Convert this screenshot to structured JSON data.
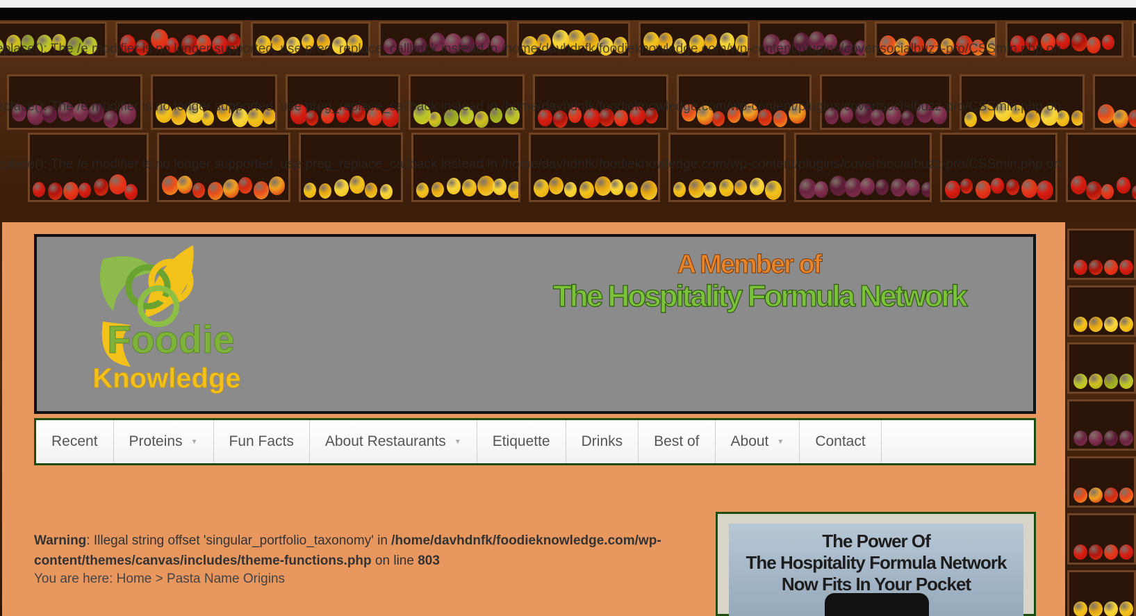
{
  "php_warnings": [
    "eplace(): The /e modifier is no longer supported, use preg_replace_callback instead in /home/davhdnfk/foodieknowledge.com/wp-content/plugins/covertsocialbuzz-pro/CSSmin.php on",
    "eplace(): The /e modifier is no longer supported, use preg_replace_callback instead in /home/davhdnfk/foodieknowledge.com/wp-content/plugins/covertsocialbuzz-pro/CSSmin.php on",
    "eplace(): The /e modifier is no longer supported, use preg_replace_callback instead in /home/davhdnfk/foodieknowledge.com/wp-content/plugins/covertsocialbuzz-pro/CSSmin.php on"
  ],
  "header": {
    "logo_line1": "Foodie",
    "logo_line2": "Knowledge",
    "member_line1": "A Member of",
    "member_line2": "The Hospitality Formula Network"
  },
  "nav": {
    "items": [
      {
        "label": "Recent",
        "dropdown": false
      },
      {
        "label": "Proteins",
        "dropdown": true
      },
      {
        "label": "Fun Facts",
        "dropdown": false
      },
      {
        "label": "About Restaurants",
        "dropdown": true
      },
      {
        "label": "Etiquette",
        "dropdown": false
      },
      {
        "label": "Drinks",
        "dropdown": false
      },
      {
        "label": "Best of",
        "dropdown": false
      },
      {
        "label": "About",
        "dropdown": true
      },
      {
        "label": "Contact",
        "dropdown": false
      }
    ]
  },
  "warning": {
    "label": "Warning",
    "text1": ": Illegal string offset 'singular_portfolio_taxonomy' in ",
    "path": "/home/davhdnfk/foodieknowledge.com/wp-content/themes/canvas/includes/theme-functions.php",
    "text2": " on line ",
    "line": "803"
  },
  "breadcrumb": {
    "prefix": "You are here: ",
    "home": "Home",
    "separator": " > ",
    "current": "Pasta Name Origins"
  },
  "sidebar_ad": {
    "line1": "The Power Of",
    "line2": "The Hospitality Formula Network",
    "line3": "Now Fits In Your Pocket"
  },
  "colors": {
    "page_bg": "#e8975f",
    "header_bg": "#8b8b8b",
    "nav_border": "#1f4a10",
    "logo_green": "#7fb23a",
    "logo_yellow": "#f2c21b",
    "member_orange": "#e8842a",
    "member_green": "#7bc23a"
  }
}
